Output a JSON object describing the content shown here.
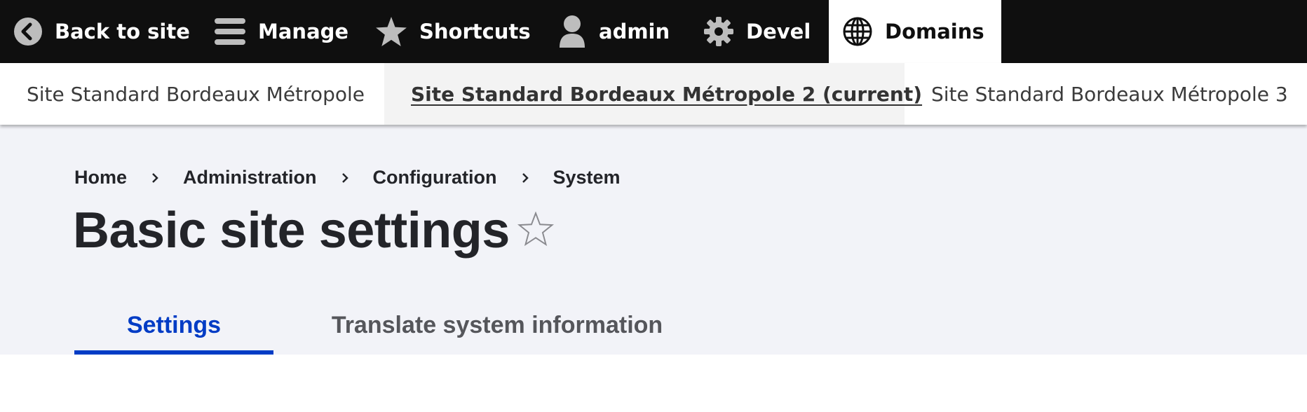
{
  "toolbar": {
    "items": [
      {
        "label": "Back to site",
        "icon": "chevron-left-circle-icon"
      },
      {
        "label": "Manage",
        "icon": "hamburger-icon"
      },
      {
        "label": "Shortcuts",
        "icon": "star-icon"
      },
      {
        "label": "admin",
        "icon": "user-icon"
      },
      {
        "label": "Devel",
        "icon": "gear-icon"
      },
      {
        "label": "Domains",
        "icon": "globe-icon",
        "active": true
      }
    ],
    "bg_color": "#0f0f0f"
  },
  "domains": {
    "items": [
      {
        "label": "Site Standard Bordeaux Métropole"
      },
      {
        "label": "Site Standard Bordeaux Métropole 2 (current)",
        "current": true
      },
      {
        "label": "Site Standard Bordeaux Métropole 3"
      }
    ]
  },
  "breadcrumb": {
    "items": [
      "Home",
      "Administration",
      "Configuration",
      "System"
    ],
    "separator_icon": "chevron-right-icon"
  },
  "page": {
    "title": "Basic site settings",
    "favorite_icon": "star-outline-icon"
  },
  "tabs": {
    "items": [
      {
        "label": "Settings",
        "active": true
      },
      {
        "label": "Translate system information"
      }
    ],
    "accent_color": "#003cc5"
  },
  "colors": {
    "header_bg": "#f2f3f8",
    "text": "#232429"
  }
}
